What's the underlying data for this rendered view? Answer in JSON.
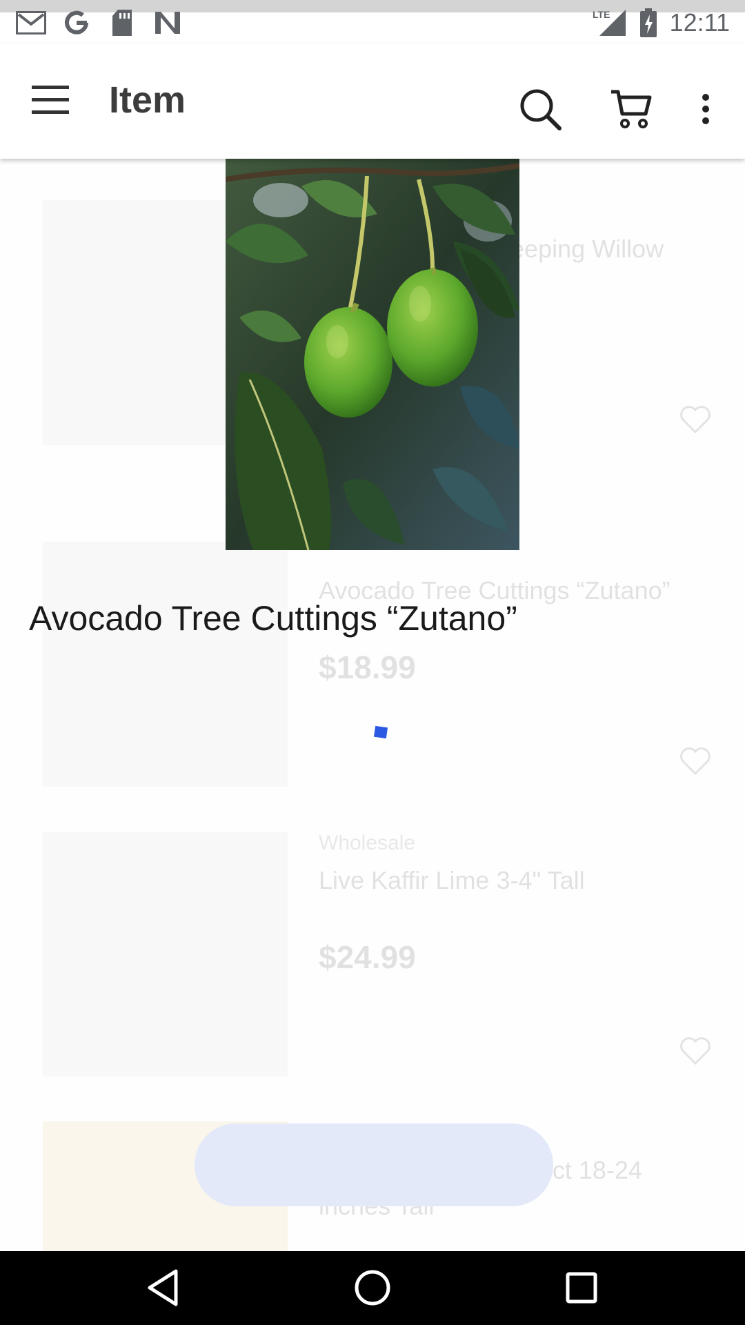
{
  "status_bar": {
    "icons": [
      "gmail-icon",
      "google-icon",
      "sd-card-icon",
      "n-app-icon"
    ],
    "network": "LTE",
    "time": "12:11"
  },
  "app_bar": {
    "title": "Item",
    "icons": [
      "menu-icon",
      "search-icon",
      "cart-icon",
      "more-vert-icon"
    ]
  },
  "preview": {
    "title": "Avocado Tree Cuttings “Zutano”",
    "image_icon": "avocado-photo"
  },
  "background_list": {
    "items": [
      {
        "seller": "",
        "name": "HEAD START! Weeping Willow Thick Trunk",
        "price": "",
        "stock": ""
      },
      {
        "seller": "",
        "name": "Avocado Tree Cuttings “Zutano”",
        "price": "$18.99",
        "stock": ""
      },
      {
        "seller": "Wholesale",
        "name": "Live Kaffir Lime 3-4\" Tall",
        "price": "$24.99",
        "stock": ""
      },
      {
        "seller": "",
        "name": "Trees (Prunus, product 18-24 inches Tall",
        "price": "",
        "stock": ""
      }
    ]
  },
  "nav_bar": {
    "icons": [
      "back-icon",
      "home-icon",
      "recents-icon"
    ]
  },
  "colors": {
    "accent": "#2b59e3",
    "nav_bar": "#000000",
    "status_bar_band": "#d4d4d4"
  }
}
